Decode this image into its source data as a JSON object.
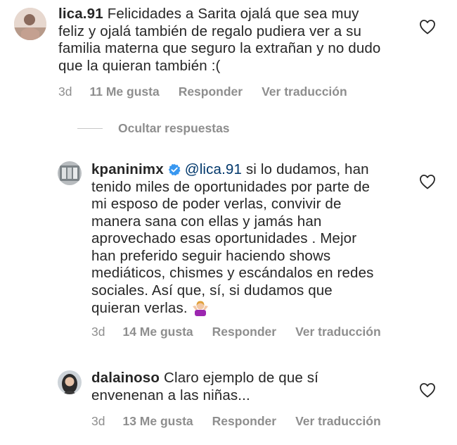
{
  "comments": [
    {
      "username": "lica.91",
      "lines": [
        "Felicidades a Sarita ojalá que sea muy",
        "feliz y ojalá también de regalo pudiera ver a su",
        "familia materna que seguro la extrañan y no dudo",
        "que la quieran también :("
      ],
      "time": "3d",
      "likes": "11 Me gusta",
      "reply": "Responder",
      "translate": "Ver traducción"
    },
    {
      "username": "kpaninimx",
      "mention": "@lica.91",
      "lines": [
        "si lo dudamos, han",
        "tenido miles de oportunidades por parte de",
        "mi esposo de poder verlas, convivir de",
        "manera sana con ellas  y jamás han",
        "aprovechado esas oportunidades . Mejor",
        "han preferido seguir haciendo shows",
        "mediáticos, chismes y escándalos en redes",
        "sociales. Así que, sí, si dudamos que",
        "quieran verlas."
      ],
      "time": "3d",
      "likes": "14 Me gusta",
      "reply": "Responder",
      "translate": "Ver traducción"
    },
    {
      "username": "dalainoso",
      "lines": [
        "Claro ejemplo de que sí",
        "envenenan a las niñas..."
      ],
      "time": "3d",
      "likes": "13 Me gusta",
      "reply": "Responder",
      "translate": "Ver traducción"
    }
  ],
  "hide_replies_label": "Ocultar respuestas",
  "icons": {
    "like": "heart-outline-icon",
    "verified": "verified-badge-icon",
    "emoji": "woman-shrugging-emoji"
  },
  "colors": {
    "text": "#262626",
    "meta": "#8e8e8e",
    "mention": "#00376b",
    "verified": "#3897f0"
  }
}
